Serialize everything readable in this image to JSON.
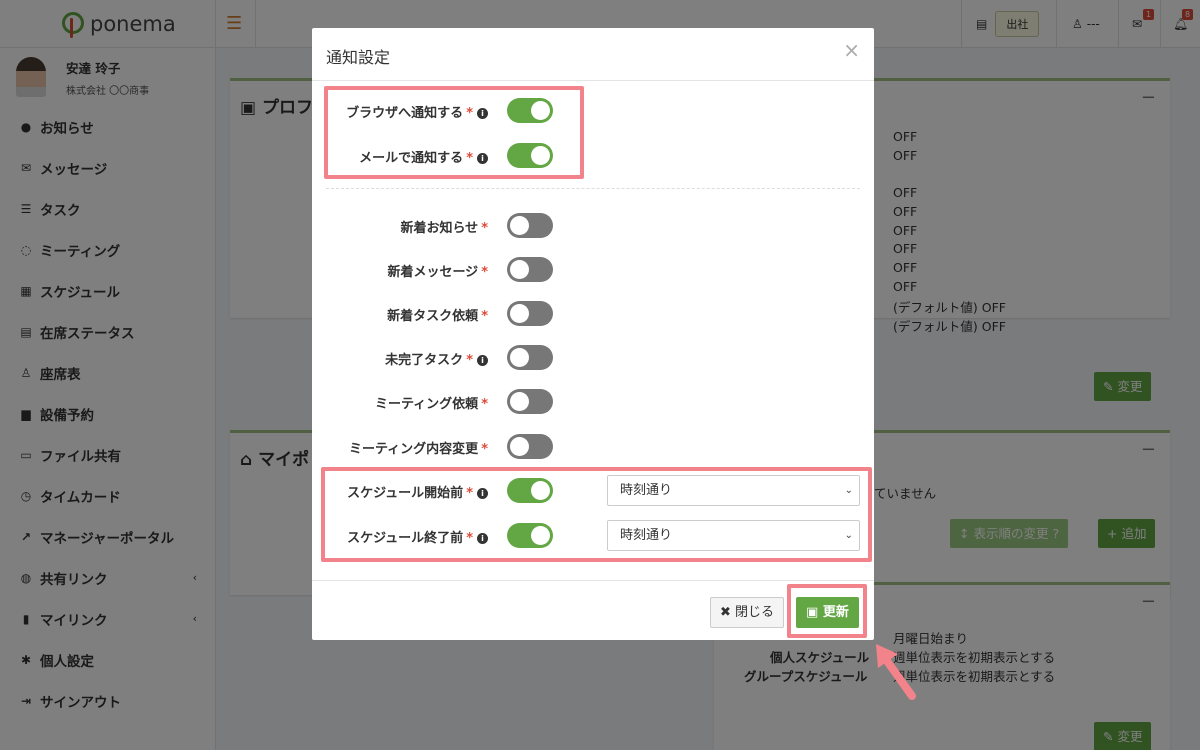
{
  "app": {
    "logo": "ponema"
  },
  "user": {
    "name": "安達 玲子",
    "company": "株式会社 〇〇商事"
  },
  "sidebar": {
    "items": [
      {
        "label": "お知らせ",
        "icon": "info-circle-icon",
        "glyph": "●"
      },
      {
        "label": "メッセージ",
        "icon": "envelope-icon",
        "glyph": "✉"
      },
      {
        "label": "タスク",
        "icon": "tasks-icon",
        "glyph": "☰"
      },
      {
        "label": "ミーティング",
        "icon": "comments-icon",
        "glyph": "◌"
      },
      {
        "label": "スケジュール",
        "icon": "calendar-icon",
        "glyph": "▦"
      },
      {
        "label": "在席ステータス",
        "icon": "presence-icon",
        "glyph": "▤"
      },
      {
        "label": "座席表",
        "icon": "seat-icon",
        "glyph": "♙"
      },
      {
        "label": "設備予約",
        "icon": "equipment-icon",
        "glyph": "▆"
      },
      {
        "label": "ファイル共有",
        "icon": "folder-icon",
        "glyph": "▭"
      },
      {
        "label": "タイムカード",
        "icon": "clock-icon",
        "glyph": "◷"
      },
      {
        "label": "マネージャーポータル",
        "icon": "chart-icon",
        "glyph": "↗"
      },
      {
        "label": "共有リンク",
        "icon": "globe-icon",
        "glyph": "◍"
      },
      {
        "label": "マイリンク",
        "icon": "bookmark-icon",
        "glyph": "▮"
      },
      {
        "label": "個人設定",
        "icon": "gear-icon",
        "glyph": "✱"
      },
      {
        "label": "サインアウト",
        "icon": "sign-out-icon",
        "glyph": "⇥"
      }
    ]
  },
  "topbar": {
    "status_badge": "出社",
    "seat": "---",
    "mail_count": "1",
    "bell_count": "8"
  },
  "background": {
    "profile_title": "プロフ",
    "mypage_title": "マイポ",
    "off_values": [
      "OFF",
      "OFF",
      "OFF",
      "OFF",
      "OFF",
      "OFF",
      "OFF",
      "OFF",
      "(デフォルト値) OFF",
      "(デフォルト値) OFF"
    ],
    "edit_label": "変更",
    "not_set_text": "ていません",
    "display_order_label": "表示順の変更",
    "add_label": "追加",
    "week_start": "月曜日始まり",
    "personal_schedule_label": "個人スケジュール",
    "personal_schedule_value": "週単位表示を初期表示とする",
    "group_schedule_label": "グループスケジュール",
    "group_schedule_value": "週単位表示を初期表示とする"
  },
  "modal": {
    "title": "通知設定",
    "close_x": "×",
    "rows": [
      {
        "label": "ブラウザへ通知する",
        "info": true,
        "on": true
      },
      {
        "label": "メールで通知する",
        "info": true,
        "on": true
      },
      {
        "label": "新着お知らせ",
        "info": false,
        "on": false
      },
      {
        "label": "新着メッセージ",
        "info": false,
        "on": false
      },
      {
        "label": "新着タスク依頼",
        "info": false,
        "on": false
      },
      {
        "label": "未完了タスク",
        "info": true,
        "on": false
      },
      {
        "label": "ミーティング依頼",
        "info": false,
        "on": false
      },
      {
        "label": "ミーティング内容変更",
        "info": false,
        "on": false
      },
      {
        "label": "スケジュール開始前",
        "info": true,
        "on": true,
        "select": "時刻通り"
      },
      {
        "label": "スケジュール終了前",
        "info": true,
        "on": true,
        "select": "時刻通り"
      }
    ],
    "close_label": "閉じる",
    "update_label": "更新"
  },
  "colors": {
    "accent": "#62a744",
    "highlight": "#f3838b",
    "danger": "#dd4b39"
  }
}
